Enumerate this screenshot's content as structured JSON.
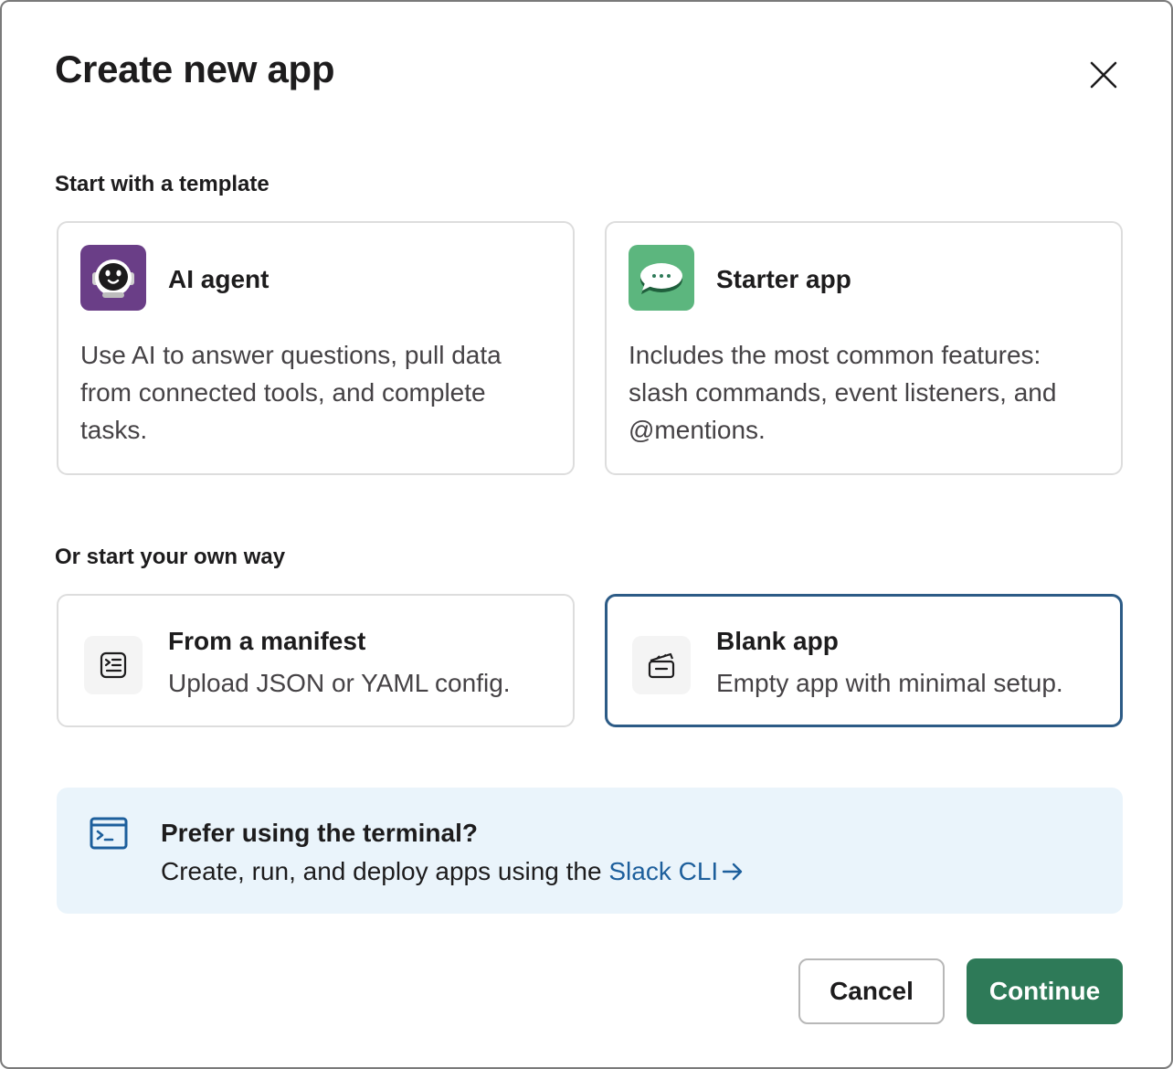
{
  "dialog": {
    "title": "Create new app"
  },
  "templates": {
    "label": "Start with a template",
    "items": [
      {
        "name": "AI agent",
        "description": "Use AI to answer questions, pull data from connected tools, and complete tasks.",
        "icon": "robot-icon",
        "color": "#6a3e87"
      },
      {
        "name": "Starter app",
        "description": "Includes the most common features: slash commands, event listeners, and @mentions.",
        "icon": "chat-bubble-icon",
        "color": "#5cb67e"
      }
    ]
  },
  "own_way": {
    "label": "Or start your own way",
    "items": [
      {
        "name": "From a manifest",
        "description": "Upload JSON or YAML config.",
        "icon": "manifest-icon",
        "selected": false
      },
      {
        "name": "Blank app",
        "description": "Empty app with minimal setup.",
        "icon": "blank-app-icon",
        "selected": true
      }
    ]
  },
  "terminal_banner": {
    "title": "Prefer using the terminal?",
    "text": "Create, run, and deploy apps using the",
    "link": "Slack CLI",
    "icon": "terminal-icon"
  },
  "footer": {
    "cancel_label": "Cancel",
    "continue_label": "Continue"
  },
  "colors": {
    "accent": "#2e7a58",
    "selected_border": "#2c5b86",
    "link": "#1d5f9c",
    "banner_bg": "#eaf4fb"
  }
}
